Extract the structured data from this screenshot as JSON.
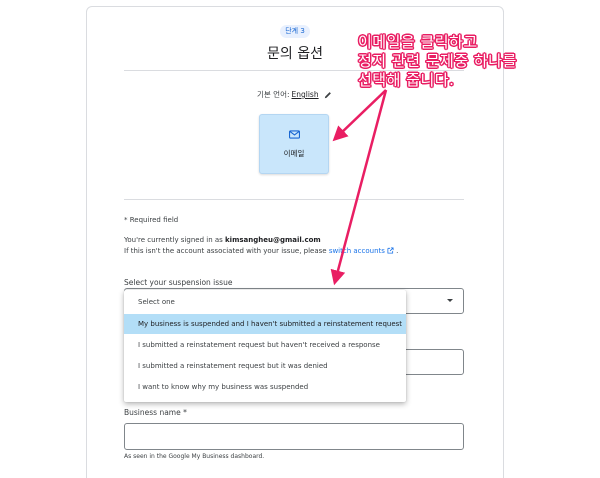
{
  "header": {
    "step_label": "단계 3",
    "title": "문의 옵션"
  },
  "language": {
    "prefix": "기본 언어:",
    "value": "English"
  },
  "contact_options": {
    "email_label": "이메일"
  },
  "account": {
    "required_note": "* Required field",
    "signed_in_prefix": "You're currently signed in as ",
    "email": "kimsangheu@gmail.com",
    "not_account_prefix": "If this isn't the account associated with your issue, please ",
    "switch_link": "switch accounts",
    "not_account_suffix": "."
  },
  "suspension": {
    "label": "Select your suspension issue",
    "placeholder": "Select one",
    "options": [
      "Select one",
      "My business is suspended and I haven't submitted a reinstatement request",
      "I submitted a reinstatement request but haven't received a response",
      "I submitted a reinstatement request but it was denied",
      "I want to know why my business was suspended"
    ],
    "selected_index": 1
  },
  "business": {
    "label": "Business name *",
    "helper": "As seen in the Google My Business dashboard."
  },
  "annotation": {
    "line1": "이메일을 클릭하고",
    "line2": "정지 관련 문제중 하나를",
    "line3": "선택해 줍니다."
  },
  "colors": {
    "accent": "#1a73e8",
    "annotation": "#e91e63",
    "tile": "#c9e6fb",
    "selected_option": "#b3def7"
  }
}
